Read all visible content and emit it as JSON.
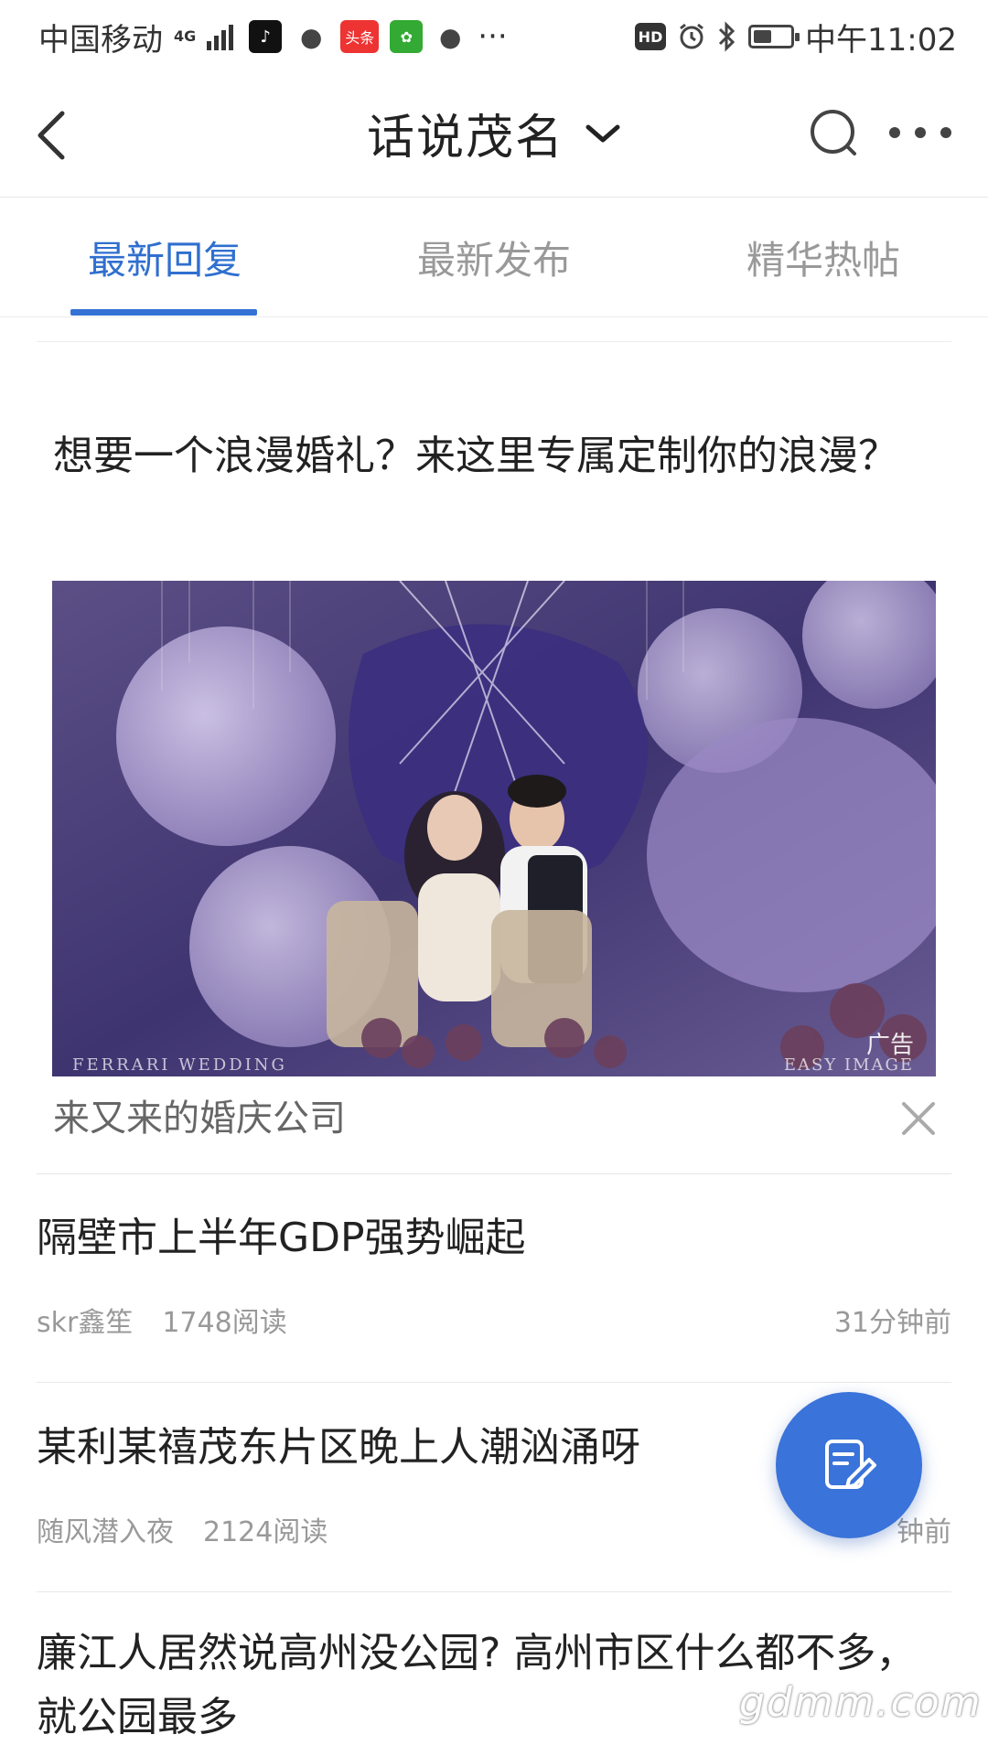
{
  "status_bar": {
    "carrier": "中国移动",
    "network": "4G",
    "app_icons": [
      "tiktok-icon",
      "wechat-icon",
      "toutiao-icon",
      "green-app-icon",
      "message-icon"
    ],
    "toutiao_label": "头条",
    "more": "···",
    "hd": "HD",
    "time": "中午11:02",
    "battery_level": 0.5
  },
  "header": {
    "title": "话说茂名"
  },
  "tabs": [
    {
      "label": "最新回复",
      "active": true
    },
    {
      "label": "最新发布",
      "active": false
    },
    {
      "label": "精华热帖",
      "active": false
    }
  ],
  "ad": {
    "title": "想要一个浪漫婚礼？来这里专属定制你的浪漫？",
    "badge": "广告",
    "watermark_left": "FERRARI WEDDING",
    "watermark_right": "EASY IMAGE",
    "source": "来又来的婚庆公司"
  },
  "posts": [
    {
      "title": "隔壁市上半年GDP强势崛起",
      "author": "skr鑫笙",
      "reads": "1748阅读",
      "time": "31分钟前"
    },
    {
      "title": "某利某禧茂东片区晚上人潮汹涌呀",
      "author": "随风潜入夜",
      "reads": "2124阅读",
      "time": "钟前"
    },
    {
      "title": "廉江人居然说高州没公园? 高州市区什么都不多，就公园最多",
      "author": "",
      "reads": "",
      "time": ""
    }
  ],
  "site_watermark": "gdmm.com",
  "colors": {
    "accent": "#3672d6",
    "fab": "#3a73d9",
    "muted_text": "#999999"
  }
}
